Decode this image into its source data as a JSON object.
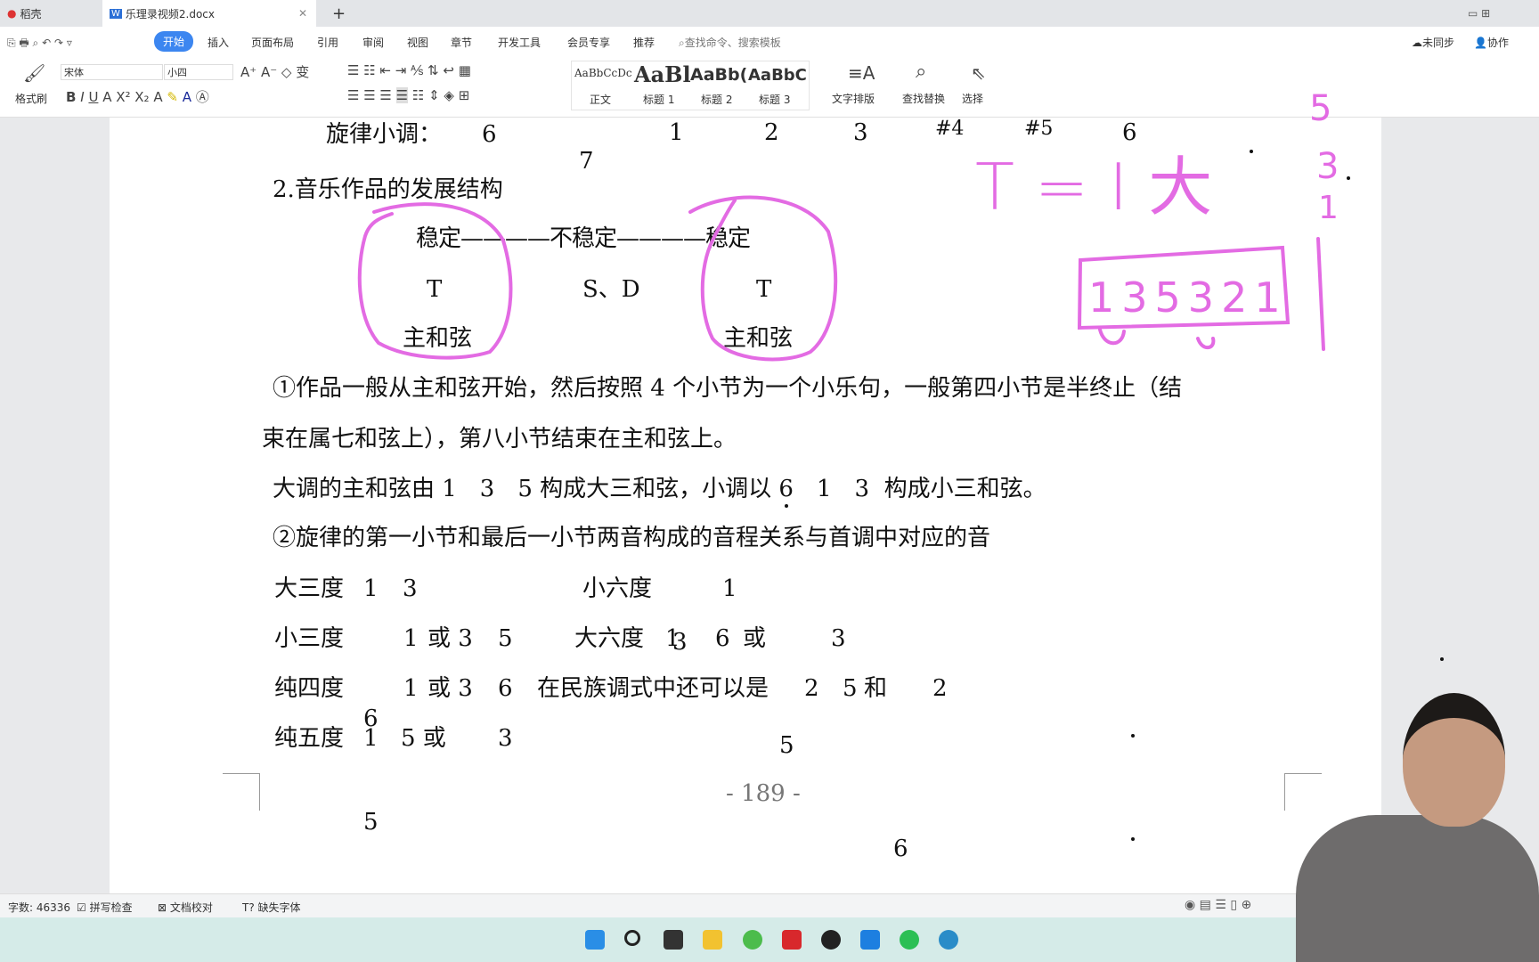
{
  "tabs": [
    {
      "label": "稻壳"
    },
    {
      "label": "乐理录视频2.docx"
    }
  ],
  "menu": {
    "items": [
      "开始",
      "插入",
      "页面布局",
      "引用",
      "审阅",
      "视图",
      "章节",
      "开发工具",
      "会员专享",
      "推荐"
    ],
    "search_placeholder": "查找命令、搜索模板",
    "sync": "未同步",
    "collab": "协作"
  },
  "ribbon": {
    "format_painter": "格式刷",
    "font": "宋体",
    "size": "小四",
    "styles": [
      {
        "preview": "AaBbCcDc",
        "label": "正文"
      },
      {
        "preview": "AaBl",
        "label": "标题 1"
      },
      {
        "preview": "AaBb(",
        "label": "标题 2"
      },
      {
        "preview": "AaBbC",
        "label": "标题 3"
      }
    ],
    "text_layout": "文字排版",
    "find_replace": "查找替换",
    "select": "选择"
  },
  "doc": {
    "row1": {
      "label": "旋律小调：",
      "notes": [
        "6",
        "7",
        "1",
        "2",
        "3",
        "#4",
        "#5",
        "6"
      ]
    },
    "heading": "2.音乐作品的发展结构",
    "diagram": {
      "line1": "稳定————不稳定————稳定",
      "t1": "T",
      "sd": "S、D",
      "t2": "T",
      "c1": "主和弦",
      "c2": "主和弦"
    },
    "p1a": "①作品一般从主和弦开始，然后按照 4 个小节为一个小乐句，一般第四小节是半终止（结",
    "p1b": "束在属七和弦上），第八小节结束在主和弦上。",
    "p2a": "大调的主和弦由 1　3　5 构成大三和弦，小调以 ",
    "p2note": "6",
    "p2b": "　1　3  构成小三和弦。",
    "p3": "②旋律的第一小节和最后一小节两音构成的音程关系与首调中对应的音",
    "intervals": [
      {
        "name": "大三度",
        "a": "1",
        "b": "3",
        "name2": "小六度",
        "c": "3",
        "d": "1"
      },
      {
        "name": "小三度",
        "a": "6",
        "b": "1",
        "c": "或 3",
        "d": "5",
        "name2": "大六度",
        "e": "1",
        "f": "6",
        "g": "或",
        "h": "5",
        "i": "3"
      },
      {
        "name": "纯四度",
        "a": "5",
        "b": "1",
        "c": "或 3",
        "d": "6",
        "ext": "在民族调式中还可以是",
        "e": "2",
        "f": "5",
        "g": "和",
        "h": "6",
        "i": "2"
      },
      {
        "name": "纯五度",
        "a": "1",
        "b": "5 或",
        "c": "6",
        "d": "3"
      }
    ],
    "page_number": "- 189 -"
  },
  "handwriting": {
    "formula": "T = I 大",
    "boxed": "135321",
    "column": [
      "5",
      "3",
      "1"
    ],
    "color": "#e36be3"
  },
  "status": {
    "word_count": "字数: 46336",
    "spell": "拼写检查",
    "proof": "文档校对",
    "missing_font": "缺失字体"
  }
}
